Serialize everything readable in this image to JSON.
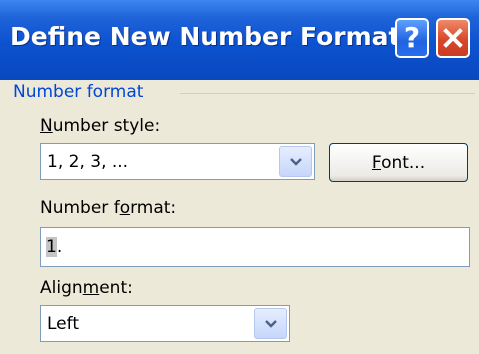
{
  "dialog": {
    "title": "Define New Number Format",
    "help_icon": "question-mark-icon",
    "close_icon": "close-x-icon"
  },
  "group": {
    "label": "Number format"
  },
  "number_style": {
    "label_pre": "",
    "label_key": "N",
    "label_post": "umber style:",
    "value": "1, 2, 3, ..."
  },
  "font_button": {
    "label_key": "F",
    "label_post": "ont..."
  },
  "number_format": {
    "label_pre": "Number f",
    "label_key": "o",
    "label_post": "rmat:",
    "value_selected": "1",
    "value_rest": "."
  },
  "alignment": {
    "label_pre": "Align",
    "label_key": "m",
    "label_post": "ent:",
    "value": "Left"
  },
  "colors": {
    "title_bar": "#0a52cf",
    "group_label": "#0046d5",
    "dialog_bg": "#ece9d8",
    "close_button": "#d9472a",
    "help_button": "#1f63e0"
  }
}
